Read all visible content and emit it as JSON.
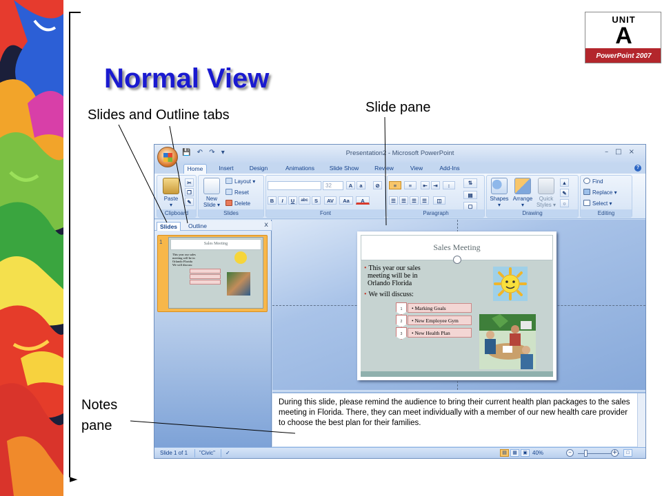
{
  "slide": {
    "title": "Normal View",
    "callouts": {
      "tabs": "Slides and Outline tabs",
      "slide_pane": "Slide pane",
      "notes_line1": "Notes",
      "notes_line2": "pane"
    }
  },
  "badge": {
    "unit_word": "UNIT",
    "unit_letter": "A",
    "product": "PowerPoint 2007"
  },
  "window": {
    "title": "Presentation2 - Microsoft PowerPoint",
    "tabs": [
      "Home",
      "Insert",
      "Design",
      "Animations",
      "Slide Show",
      "Review",
      "View",
      "Add-Ins"
    ],
    "active_tab": "Home",
    "ribbon": {
      "clipboard": {
        "label": "Clipboard",
        "paste": "Paste"
      },
      "slides": {
        "label": "Slides",
        "new_slide_line1": "New",
        "new_slide_line2": "Slide",
        "layout": "Layout",
        "reset": "Reset",
        "delete": "Delete"
      },
      "font": {
        "label": "Font",
        "size": "32"
      },
      "paragraph": {
        "label": "Paragraph"
      },
      "drawing": {
        "label": "Drawing",
        "shapes": "Shapes",
        "arrange": "Arrange",
        "quick_styles_line1": "Quick",
        "quick_styles_line2": "Styles"
      },
      "editing": {
        "label": "Editing",
        "find": "Find",
        "replace": "Replace",
        "select": "Select"
      }
    },
    "panel": {
      "tab_slides": "Slides",
      "tab_outline": "Outline",
      "close": "x",
      "thumb_number": "1"
    },
    "slide_content": {
      "title": "Sales Meeting",
      "bullet1": [
        "This year our sales",
        "meeting will be in",
        "Orlando Florida"
      ],
      "bullet2": "We will discuss:",
      "items": [
        "Marking Goals",
        "New Employee Gym",
        "New Health Plan"
      ],
      "item_numbers": [
        "1",
        "2",
        "3"
      ]
    },
    "notes": "During this slide, please remind the audience to bring their current health plan packages to the sales meeting in Florida. There, they can meet individually with a member of our new health care provider to choose the best plan for their families.",
    "status": {
      "slide_count": "Slide 1 of 1",
      "theme": "\"Civic\"",
      "zoom": "40%"
    }
  }
}
